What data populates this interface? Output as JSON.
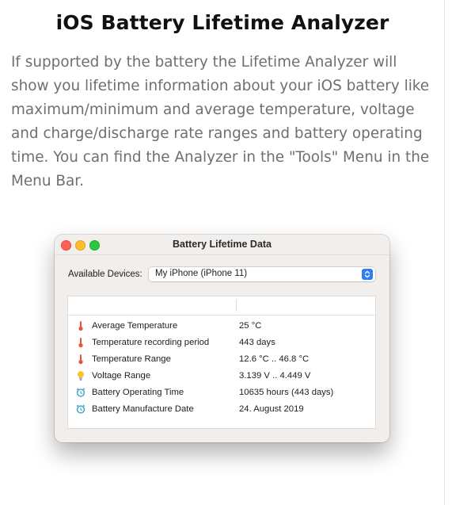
{
  "page": {
    "title": "iOS Battery Lifetime Analyzer",
    "intro": "If supported by the battery the Lifetime Analyzer will show you lifetime information about your iOS battery like maximum/minimum and average temperature, voltage and charge/discharge rate ranges and battery operating time. You can find the Analyzer in the \"Tools\" Menu in the Menu Bar."
  },
  "window": {
    "title": "Battery Lifetime Data",
    "controls": [
      "close",
      "minimize",
      "zoom"
    ],
    "device_label": "Available Devices:",
    "device_selected": "My iPhone (iPhone 11)",
    "rows": [
      {
        "icon": "thermometer-icon",
        "label": "Average Temperature",
        "value": "25 °C"
      },
      {
        "icon": "thermometer-icon",
        "label": "Temperature recording period",
        "value": "443 days"
      },
      {
        "icon": "thermometer-icon",
        "label": "Temperature Range",
        "value": "12.6 °C .. 46.8 °C"
      },
      {
        "icon": "lightbulb-icon",
        "label": "Voltage Range",
        "value": "3.139 V .. 4.449 V"
      },
      {
        "icon": "alarm-clock-icon",
        "label": "Battery Operating Time",
        "value": "10635 hours (443 days)"
      },
      {
        "icon": "alarm-clock-icon",
        "label": "Battery Manufacture Date",
        "value": "24. August 2019"
      }
    ]
  },
  "colors": {
    "accent": "#2f7cf6",
    "close": "#ff5f57",
    "minimize": "#febc2e",
    "zoom": "#28c840",
    "thermometer": "#e8543a",
    "bulb": "#f5c32c",
    "clock": "#3aa0c8"
  }
}
